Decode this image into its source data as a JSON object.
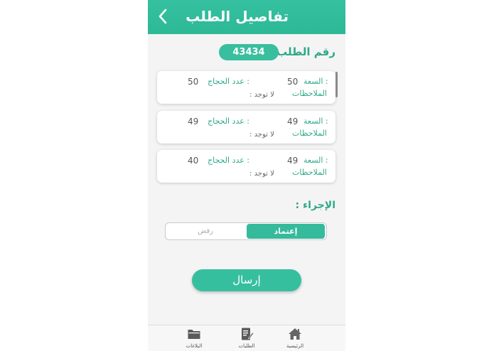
{
  "header": {
    "title": "تفاصيل الطلب"
  },
  "order": {
    "label": "رقم الطلب :",
    "number": "43434"
  },
  "groups": [
    {
      "capacity_label": "السعة :",
      "capacity": "50",
      "pilgrims_label": "عدد الحجاج :",
      "pilgrims": "50",
      "notes_label": "الملاحظات",
      "notes": ": لا توجد"
    },
    {
      "capacity_label": "السعة :",
      "capacity": "49",
      "pilgrims_label": "عدد الحجاج :",
      "pilgrims": "49",
      "notes_label": "الملاحظات",
      "notes": ": لا توجد"
    },
    {
      "capacity_label": "السعة :",
      "capacity": "49",
      "pilgrims_label": "عدد الحجاج :",
      "pilgrims": "40",
      "notes_label": "الملاحظات",
      "notes": ": لا توجد"
    }
  ],
  "action": {
    "label": "الإجراء :",
    "approve_label": "إعتماد",
    "reject_label": "رفض",
    "selected": "approve"
  },
  "submit_label": "إرسال",
  "tabs": [
    {
      "label": "الرئيسية",
      "icon": "home-icon"
    },
    {
      "label": "الطلبات",
      "icon": "requests-icon"
    },
    {
      "label": "البلاغات",
      "icon": "reports-folder-icon"
    }
  ],
  "colors": {
    "accent": "#35c1a0",
    "text_accent": "#2fa889"
  }
}
